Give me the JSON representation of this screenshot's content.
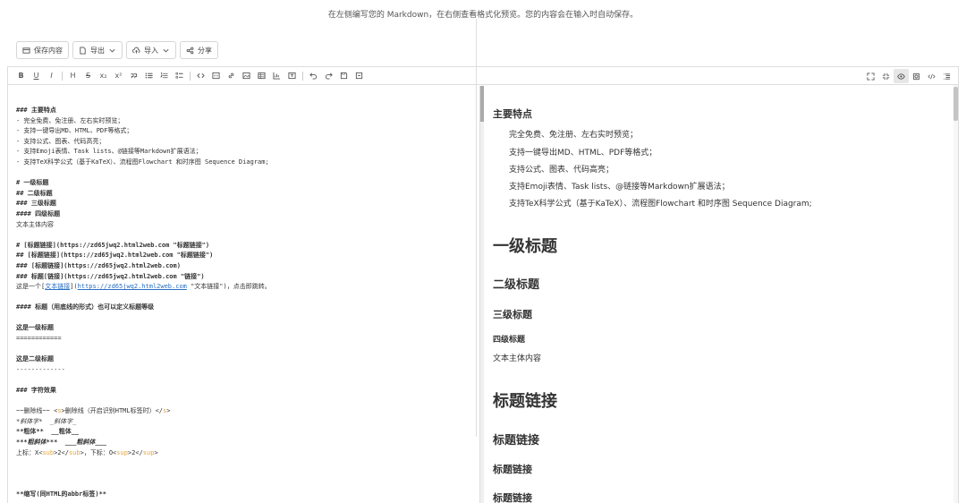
{
  "header": {
    "subtitle": "在左侧编写您的 Markdown，在右侧查看格式化预览。您的内容会在输入时自动保存。"
  },
  "actions": {
    "save": "保存内容",
    "export": "导出",
    "import": "导入",
    "share": "分享"
  },
  "toolbar": {
    "bold": "B",
    "underline": "U",
    "italic": "I",
    "heading": "H",
    "strike": "S",
    "sub": "x₂",
    "sup": "x²"
  },
  "source": {
    "l01": "### 主要特点",
    "l02": "- 完全免费、免注册、左右实时预览；",
    "l03": "- 支持一键导出MD、HTML、PDF等格式；",
    "l04": "- 支持公式、图表、代码高亮；",
    "l05": "- 支持Emoji表情、Task lists、@链接等Markdown扩展语法；",
    "l06": "- 支持TeX科学公式（基于KaTeX）、流程图Flowchart 和时序图 Sequence Diagram;",
    "l08": "# 一级标题",
    "l09": "## 二级标题",
    "l10": "### 三级标题",
    "l11": "#### 四级标题",
    "l12": "文本主体内容",
    "l14": "# [标题链接](https://zd65jwq2.html2web.com \"标题链接\")",
    "l15": "## [标题链接](https://zd65jwq2.html2web.com \"标题链接\")",
    "l16": "### [标题链接](https://zd65jwq2.html2web.com)",
    "l17": "### 标题[链接](https://zd65jwq2.html2web.com \"链接\")",
    "l18a": "这是一个[",
    "l18b": "文本链接",
    "l18c": "](",
    "l18d": "https://zd65jwq2.html2web.com",
    "l18e": " \"文本链接\")，点击即跳转。",
    "l20": "#### 标题（用底线的形式）也可以定义标题等级",
    "l22": "这是一级标题",
    "l23": "============",
    "l25": "这是二级标题",
    "l26": "-------------",
    "l28": "### 字符效果",
    "l30a": "~~删除线~~ <",
    "l30b": "s",
    "l30c": ">删除线（开启识别HTML标签时）</",
    "l30d": "s",
    "l30e": ">",
    "l31": "*斜体字*  _斜体字_",
    "l32": "**粗体**  __粗体__",
    "l33": "***粗斜体***  ___粗斜体___",
    "l34a": "上标：X<",
    "l34b": "sub",
    "l34c": ">2</",
    "l34d": "sub",
    "l34e": ">，下标：O<",
    "l34f": "sup",
    "l34g": ">2</",
    "l34h": "sup",
    "l34i": ">",
    "l38": "**缩写(同HTML的abbr标签)**"
  },
  "preview": {
    "h3_features": "主要特点",
    "features": [
      "完全免费、免注册、左右实时预览；",
      "支持一键导出MD、HTML、PDF等格式；",
      "支持公式、图表、代码高亮；",
      "支持Emoji表情、Task lists、@链接等Markdown扩展语法；",
      "支持TeX科学公式（基于KaTeX）、流程图Flowchart 和时序图 Sequence Diagram;"
    ],
    "h1": "一级标题",
    "h2": "二级标题",
    "h3": "三级标题",
    "h4": "四级标题",
    "body": "文本主体内容",
    "link_h1": "标题链接",
    "link_h2": "标题链接",
    "link_h3": "标题链接",
    "link_h3b": "标题链接"
  },
  "colors": {
    "link": "#2a6fc2",
    "tag": "#e8a33a",
    "border": "#dddddd",
    "accent_text": "#333333"
  }
}
